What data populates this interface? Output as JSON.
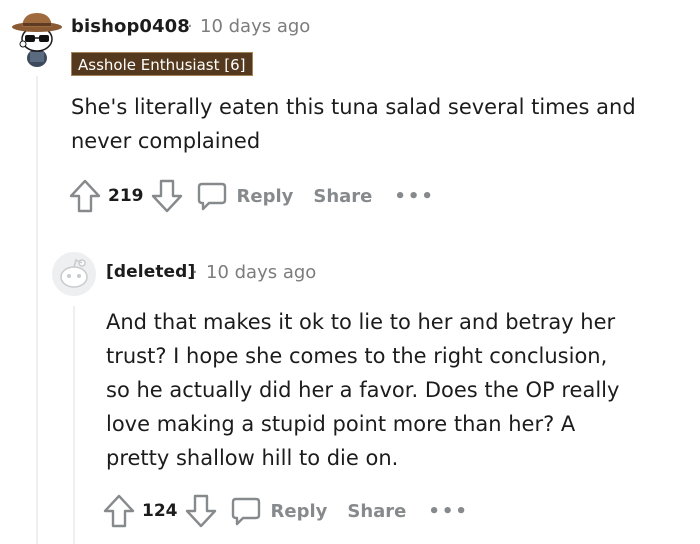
{
  "comments": [
    {
      "author": "bishop0408",
      "separator": "·",
      "time": "10 days ago",
      "flair": "Asshole Enthusiast [6]",
      "body_lines": [
        "She's literally eaten this tuna salad several times and",
        "never complained"
      ],
      "votes": "219",
      "reply_label": "Reply",
      "share_label": "Share",
      "more_label": "•••",
      "avatar_icon": "snoo-cowboy-sunglasses-avatar"
    },
    {
      "author": "[deleted]",
      "separator": "·",
      "time": "10 days ago",
      "body_lines": [
        "And that makes it ok to lie to her and betray her",
        "trust? I hope she comes to the right conclusion,",
        "so he actually did her a favor. Does the OP really",
        "love making a stupid point more than her? A",
        "pretty shallow hill to die on."
      ],
      "votes": "124",
      "reply_label": "Reply",
      "share_label": "Share",
      "more_label": "•••",
      "avatar_icon": "deleted-user-avatar"
    }
  ],
  "colors": {
    "flair_bg": "#54391e",
    "meta_gray": "#878a8c",
    "thread_line": "#edeff1",
    "text": "#1c1c1c"
  }
}
